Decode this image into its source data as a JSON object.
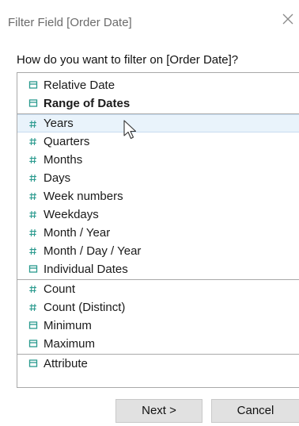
{
  "dialog": {
    "title": "Filter Field [Order Date]",
    "prompt": "How do you want to filter on [Order Date]?"
  },
  "list": {
    "groups": [
      [
        {
          "label": "Relative Date",
          "icon": "calendar-icon",
          "bold": false
        },
        {
          "label": "Range of Dates",
          "icon": "calendar-icon",
          "bold": true
        }
      ],
      [
        {
          "label": "Years",
          "icon": "hash-icon",
          "selected": true
        },
        {
          "label": "Quarters",
          "icon": "hash-icon"
        },
        {
          "label": "Months",
          "icon": "hash-icon"
        },
        {
          "label": "Days",
          "icon": "hash-icon"
        },
        {
          "label": "Week numbers",
          "icon": "hash-icon"
        },
        {
          "label": "Weekdays",
          "icon": "hash-icon"
        },
        {
          "label": "Month / Year",
          "icon": "hash-icon"
        },
        {
          "label": "Month / Day / Year",
          "icon": "hash-icon"
        },
        {
          "label": "Individual Dates",
          "icon": "calendar-icon"
        }
      ],
      [
        {
          "label": "Count",
          "icon": "hash-icon"
        },
        {
          "label": "Count (Distinct)",
          "icon": "hash-icon"
        },
        {
          "label": "Minimum",
          "icon": "calendar-icon"
        },
        {
          "label": "Maximum",
          "icon": "calendar-icon"
        }
      ],
      [
        {
          "label": "Attribute",
          "icon": "calendar-icon"
        }
      ]
    ]
  },
  "buttons": {
    "next": "Next >",
    "cancel": "Cancel"
  },
  "colors": {
    "icon_teal": "#2a9a8e",
    "selection": "#e9f3fb",
    "border": "#a9a9a9"
  }
}
